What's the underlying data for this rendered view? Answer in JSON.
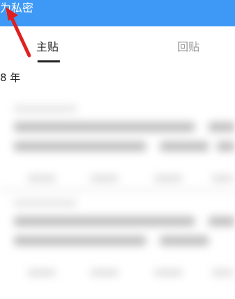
{
  "top_bar": {
    "visible_text": "为私密",
    "color": "#3d99f5"
  },
  "tabs": [
    {
      "label": "主贴",
      "selected": true
    },
    {
      "label": "回贴",
      "selected": false
    }
  ],
  "list": {
    "year_label": "8 年"
  },
  "annotation": {
    "arrow_color": "#e02020"
  }
}
